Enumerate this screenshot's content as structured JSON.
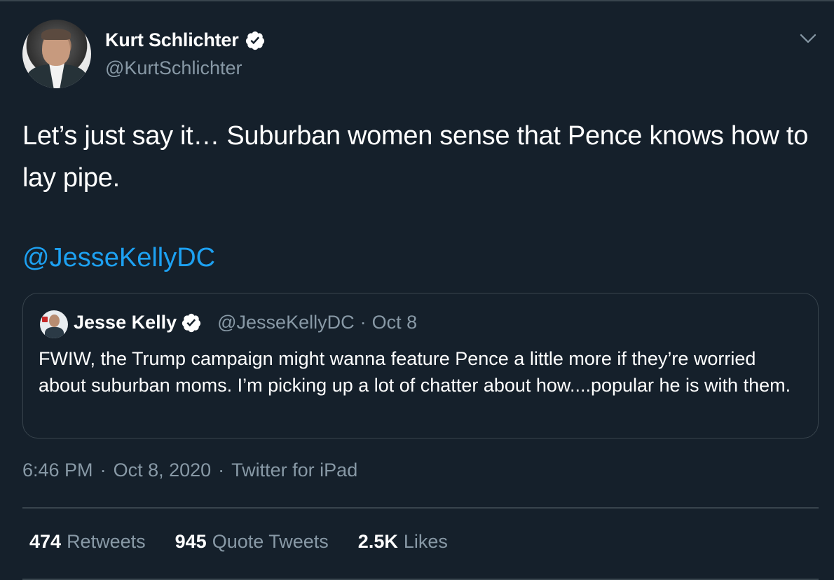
{
  "tweet": {
    "author": {
      "display_name": "Kurt Schlichter",
      "handle": "@KurtSchlichter",
      "verified": true
    },
    "text": "Let’s just say it… Suburban women sense that Pence knows how to lay pipe.",
    "mention": "@JesseKellyDC",
    "quoted": {
      "display_name": "Jesse Kelly",
      "handle": "@JesseKellyDC",
      "separator": "·",
      "date": "Oct 8",
      "verified": true,
      "text": "FWIW, the Trump campaign might wanna feature Pence a little more if they’re worried about suburban moms. I’m picking up a lot of chatter about how....popular he is with them."
    },
    "meta": {
      "time": "6:46 PM",
      "date": "Oct 8, 2020",
      "source": "Twitter for iPad",
      "separator": "·"
    },
    "stats": {
      "retweets_count": "474",
      "retweets_label": "Retweets",
      "quotes_count": "945",
      "quotes_label": "Quote Tweets",
      "likes_count": "2.5K",
      "likes_label": "Likes"
    }
  },
  "icons": {
    "verified": "verified-badge-icon",
    "more": "chevron-down-icon"
  },
  "colors": {
    "background": "#15202b",
    "text_primary": "#ffffff",
    "text_secondary": "#8899a6",
    "accent": "#1da1f2",
    "border": "#38444d"
  }
}
